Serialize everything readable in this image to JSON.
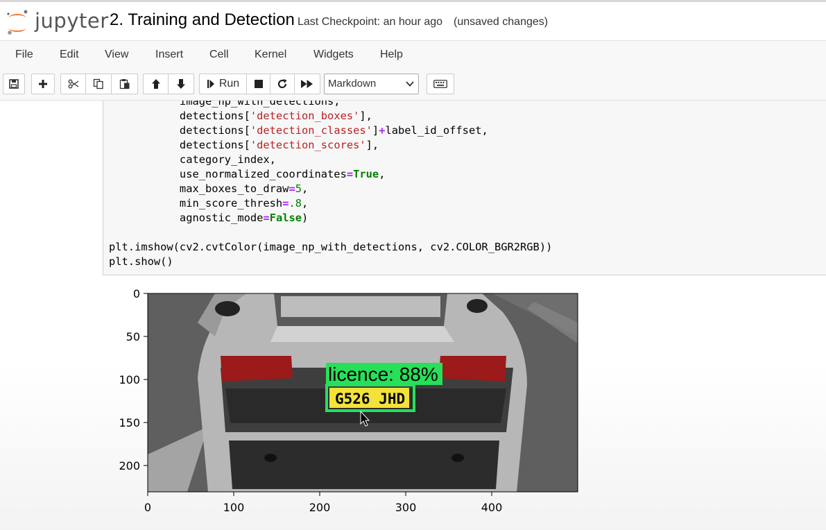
{
  "header": {
    "logo_text": "jupyter",
    "notebook_title": "2. Training and Detection",
    "checkpoint": "Last Checkpoint: an hour ago",
    "unsaved": "(unsaved changes)"
  },
  "menu": [
    "File",
    "Edit",
    "View",
    "Insert",
    "Cell",
    "Kernel",
    "Widgets",
    "Help"
  ],
  "toolbar": {
    "run_label": "Run",
    "cell_type": "Markdown",
    "cell_type_options": [
      "Markdown"
    ]
  },
  "code_lines": [
    "           image_np_with_detections,",
    "           detections['detection_boxes'],",
    "           detections['detection_classes']+label_id_offset,",
    "           detections['detection_scores'],",
    "           category_index,",
    "           use_normalized_coordinates=True,",
    "           max_boxes_to_draw=5,",
    "           min_score_thresh=.8,",
    "           agnostic_mode=False)",
    "",
    "plt.imshow(cv2.cvtColor(image_np_with_detections, cv2.COLOR_BGR2RGB))",
    "plt.show()"
  ],
  "plot": {
    "x_ticks": [
      "0",
      "100",
      "200",
      "300",
      "400"
    ],
    "y_ticks": [
      "0",
      "50",
      "100",
      "150",
      "200"
    ],
    "detection_label": "licence: 88%",
    "plate_text": "G526 JHD",
    "box_color": "#27e05a",
    "plate_color": "#f2e23a"
  },
  "colors": {
    "string": "#ba2121",
    "keyword": "#008000",
    "operator": "#aa22ff",
    "jupyter_orange": "#f37726"
  }
}
